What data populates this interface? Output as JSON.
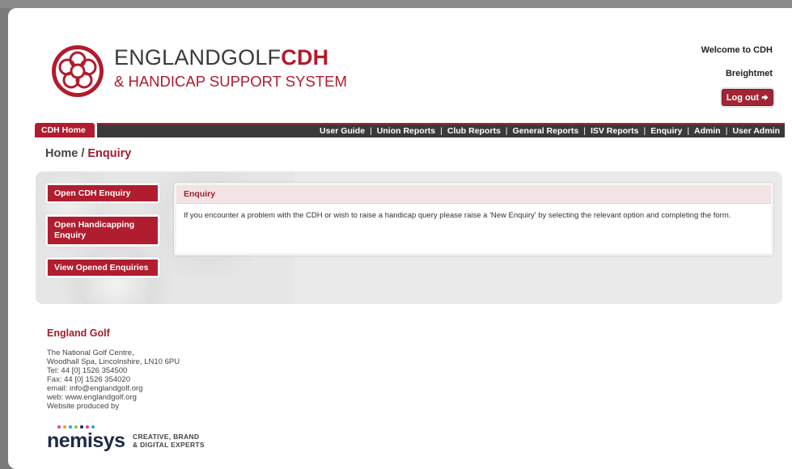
{
  "header": {
    "brand_line1_part1": "ENGLANDGOLF",
    "brand_line1_part2": "CDH",
    "brand_line2": "& HANDICAP SUPPORT SYSTEM",
    "welcome": "Welcome to CDH",
    "club": "Breightmet",
    "logout_label": "Log out",
    "logout_icon": "arrow-right-icon"
  },
  "nav": {
    "home": "CDH Home",
    "items": [
      "User Guide",
      "Union Reports",
      "Club Reports",
      "General Reports",
      "ISV Reports",
      "Enquiry",
      "Admin",
      "User Admin"
    ],
    "separator": "|"
  },
  "breadcrumb": {
    "home": "Home",
    "separator": "/",
    "current": "Enquiry"
  },
  "sidebar": {
    "buttons": [
      "Open CDH Enquiry",
      "Open Handicapping Enquiry",
      "View Opened Enquiries"
    ]
  },
  "enquiry": {
    "title": "Enquiry",
    "body": "If you encounter a problem with the CDH or wish to raise a handicap query please raise a 'New Enquiry' by selecting the relevant option and completing the form."
  },
  "footer": {
    "title": "England Golf",
    "address_lines": [
      "The National Golf Centre,",
      "Woodhall Spa, Lincolnshire, LN10 6PU",
      "Tel: 44 [0] 1526 354500",
      "Fax: 44 [0] 1526 354020",
      "email: info@englandgolf.org",
      "web:  www.englandgolf.org",
      "Website produced by"
    ],
    "producer": "nemisys",
    "producer_tag_line1": "CREATIVE, BRAND",
    "producer_tag_line2": "& DIGITAL EXPERTS"
  },
  "colors": {
    "brand_red": "#b01d2f",
    "nav_dark": "#3a3a3a",
    "panel_bg": "#eaeaea",
    "enquiry_header_bg": "#f3e3e5"
  }
}
